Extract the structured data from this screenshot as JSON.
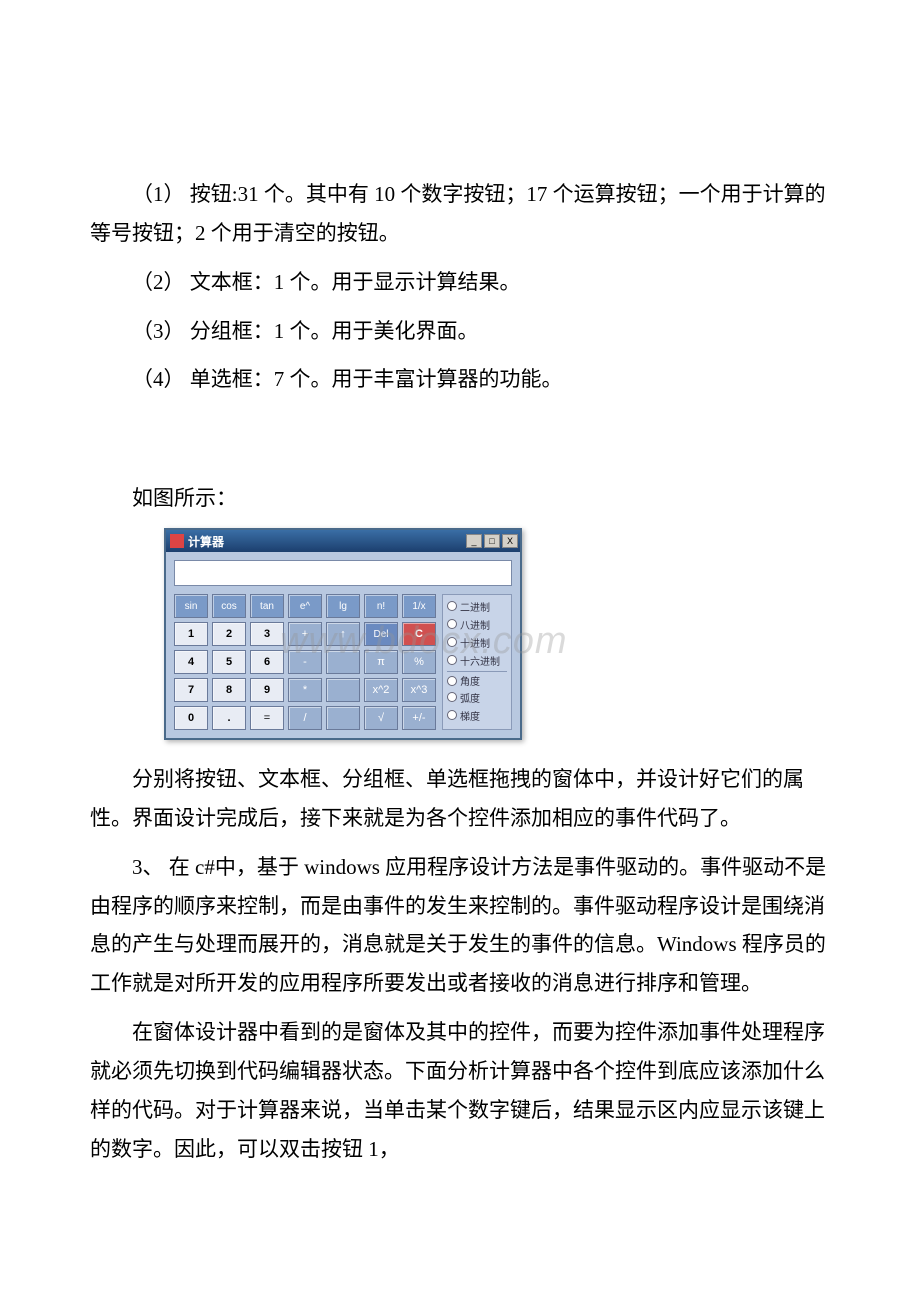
{
  "paragraphs": {
    "p1": "（1） 按钮:31 个。其中有 10 个数字按钮；17 个运算按钮；一个用于计算的等号按钮；2 个用于清空的按钮。",
    "p2": "（2） 文本框：1 个。用于显示计算结果。",
    "p3": "（3） 分组框：1 个。用于美化界面。",
    "p4": "（4） 单选框：7 个。用于丰富计算器的功能。",
    "p5": "如图所示：",
    "p6": "分别将按钮、文本框、分组框、单选框拖拽的窗体中，并设计好它们的属性。界面设计完成后，接下来就是为各个控件添加相应的事件代码了。",
    "p7": "3、 在 c#中，基于 windows 应用程序设计方法是事件驱动的。事件驱动不是由程序的顺序来控制，而是由事件的发生来控制的。事件驱动程序设计是围绕消息的产生与处理而展开的，消息就是关于发生的事件的信息。Windows 程序员的工作就是对所开发的应用程序所要发出或者接收的消息进行排序和管理。",
    "p8": "在窗体设计器中看到的是窗体及其中的控件，而要为控件添加事件处理程序就必须先切换到代码编辑器状态。下面分析计算器中各个控件到底应该添加什么样的代码。对于计算器来说，当单击某个数字键后，结果显示区内应显示该键上的数字。因此，可以双击按钮 1，"
  },
  "watermark": "www.bdocx.com",
  "calculator": {
    "title": "计算器",
    "winbuttons": {
      "min": "_",
      "max": "□",
      "close": "X"
    },
    "rows": [
      [
        {
          "label": "sin",
          "cls": "fn"
        },
        {
          "label": "cos",
          "cls": "fn"
        },
        {
          "label": "tan",
          "cls": "fn"
        },
        {
          "label": "e^",
          "cls": "fn"
        },
        {
          "label": "lg",
          "cls": "fn"
        },
        {
          "label": "n!",
          "cls": "fn"
        },
        {
          "label": "1/x",
          "cls": "fn"
        }
      ],
      [
        {
          "label": "1",
          "cls": "num"
        },
        {
          "label": "2",
          "cls": "num"
        },
        {
          "label": "3",
          "cls": "num"
        },
        {
          "label": "+",
          "cls": "op"
        },
        {
          "label": "↑",
          "cls": "op"
        },
        {
          "label": "Del",
          "cls": "del"
        },
        {
          "label": "C",
          "cls": "c"
        }
      ],
      [
        {
          "label": "4",
          "cls": "num"
        },
        {
          "label": "5",
          "cls": "num"
        },
        {
          "label": "6",
          "cls": "num"
        },
        {
          "label": "-",
          "cls": "op"
        },
        {
          "label": "",
          "cls": "op"
        },
        {
          "label": "π",
          "cls": "op"
        },
        {
          "label": "%",
          "cls": "op"
        }
      ],
      [
        {
          "label": "7",
          "cls": "num"
        },
        {
          "label": "8",
          "cls": "num"
        },
        {
          "label": "9",
          "cls": "num"
        },
        {
          "label": "*",
          "cls": "op"
        },
        {
          "label": "",
          "cls": "op"
        },
        {
          "label": "x^2",
          "cls": "op"
        },
        {
          "label": "x^3",
          "cls": "op"
        }
      ],
      [
        {
          "label": "0",
          "cls": "num"
        },
        {
          "label": ".",
          "cls": "num"
        },
        {
          "label": "=",
          "cls": "eq"
        },
        {
          "label": "/",
          "cls": "op"
        },
        {
          "label": "",
          "cls": "op"
        },
        {
          "label": "√",
          "cls": "op"
        },
        {
          "label": "+/-",
          "cls": "op"
        }
      ]
    ],
    "radios": [
      {
        "label": "二进制"
      },
      {
        "label": "八进制"
      },
      {
        "label": "十进制"
      },
      {
        "label": "十六进制"
      },
      {
        "label": "角度"
      },
      {
        "label": "弧度"
      },
      {
        "label": "梯度"
      }
    ]
  }
}
